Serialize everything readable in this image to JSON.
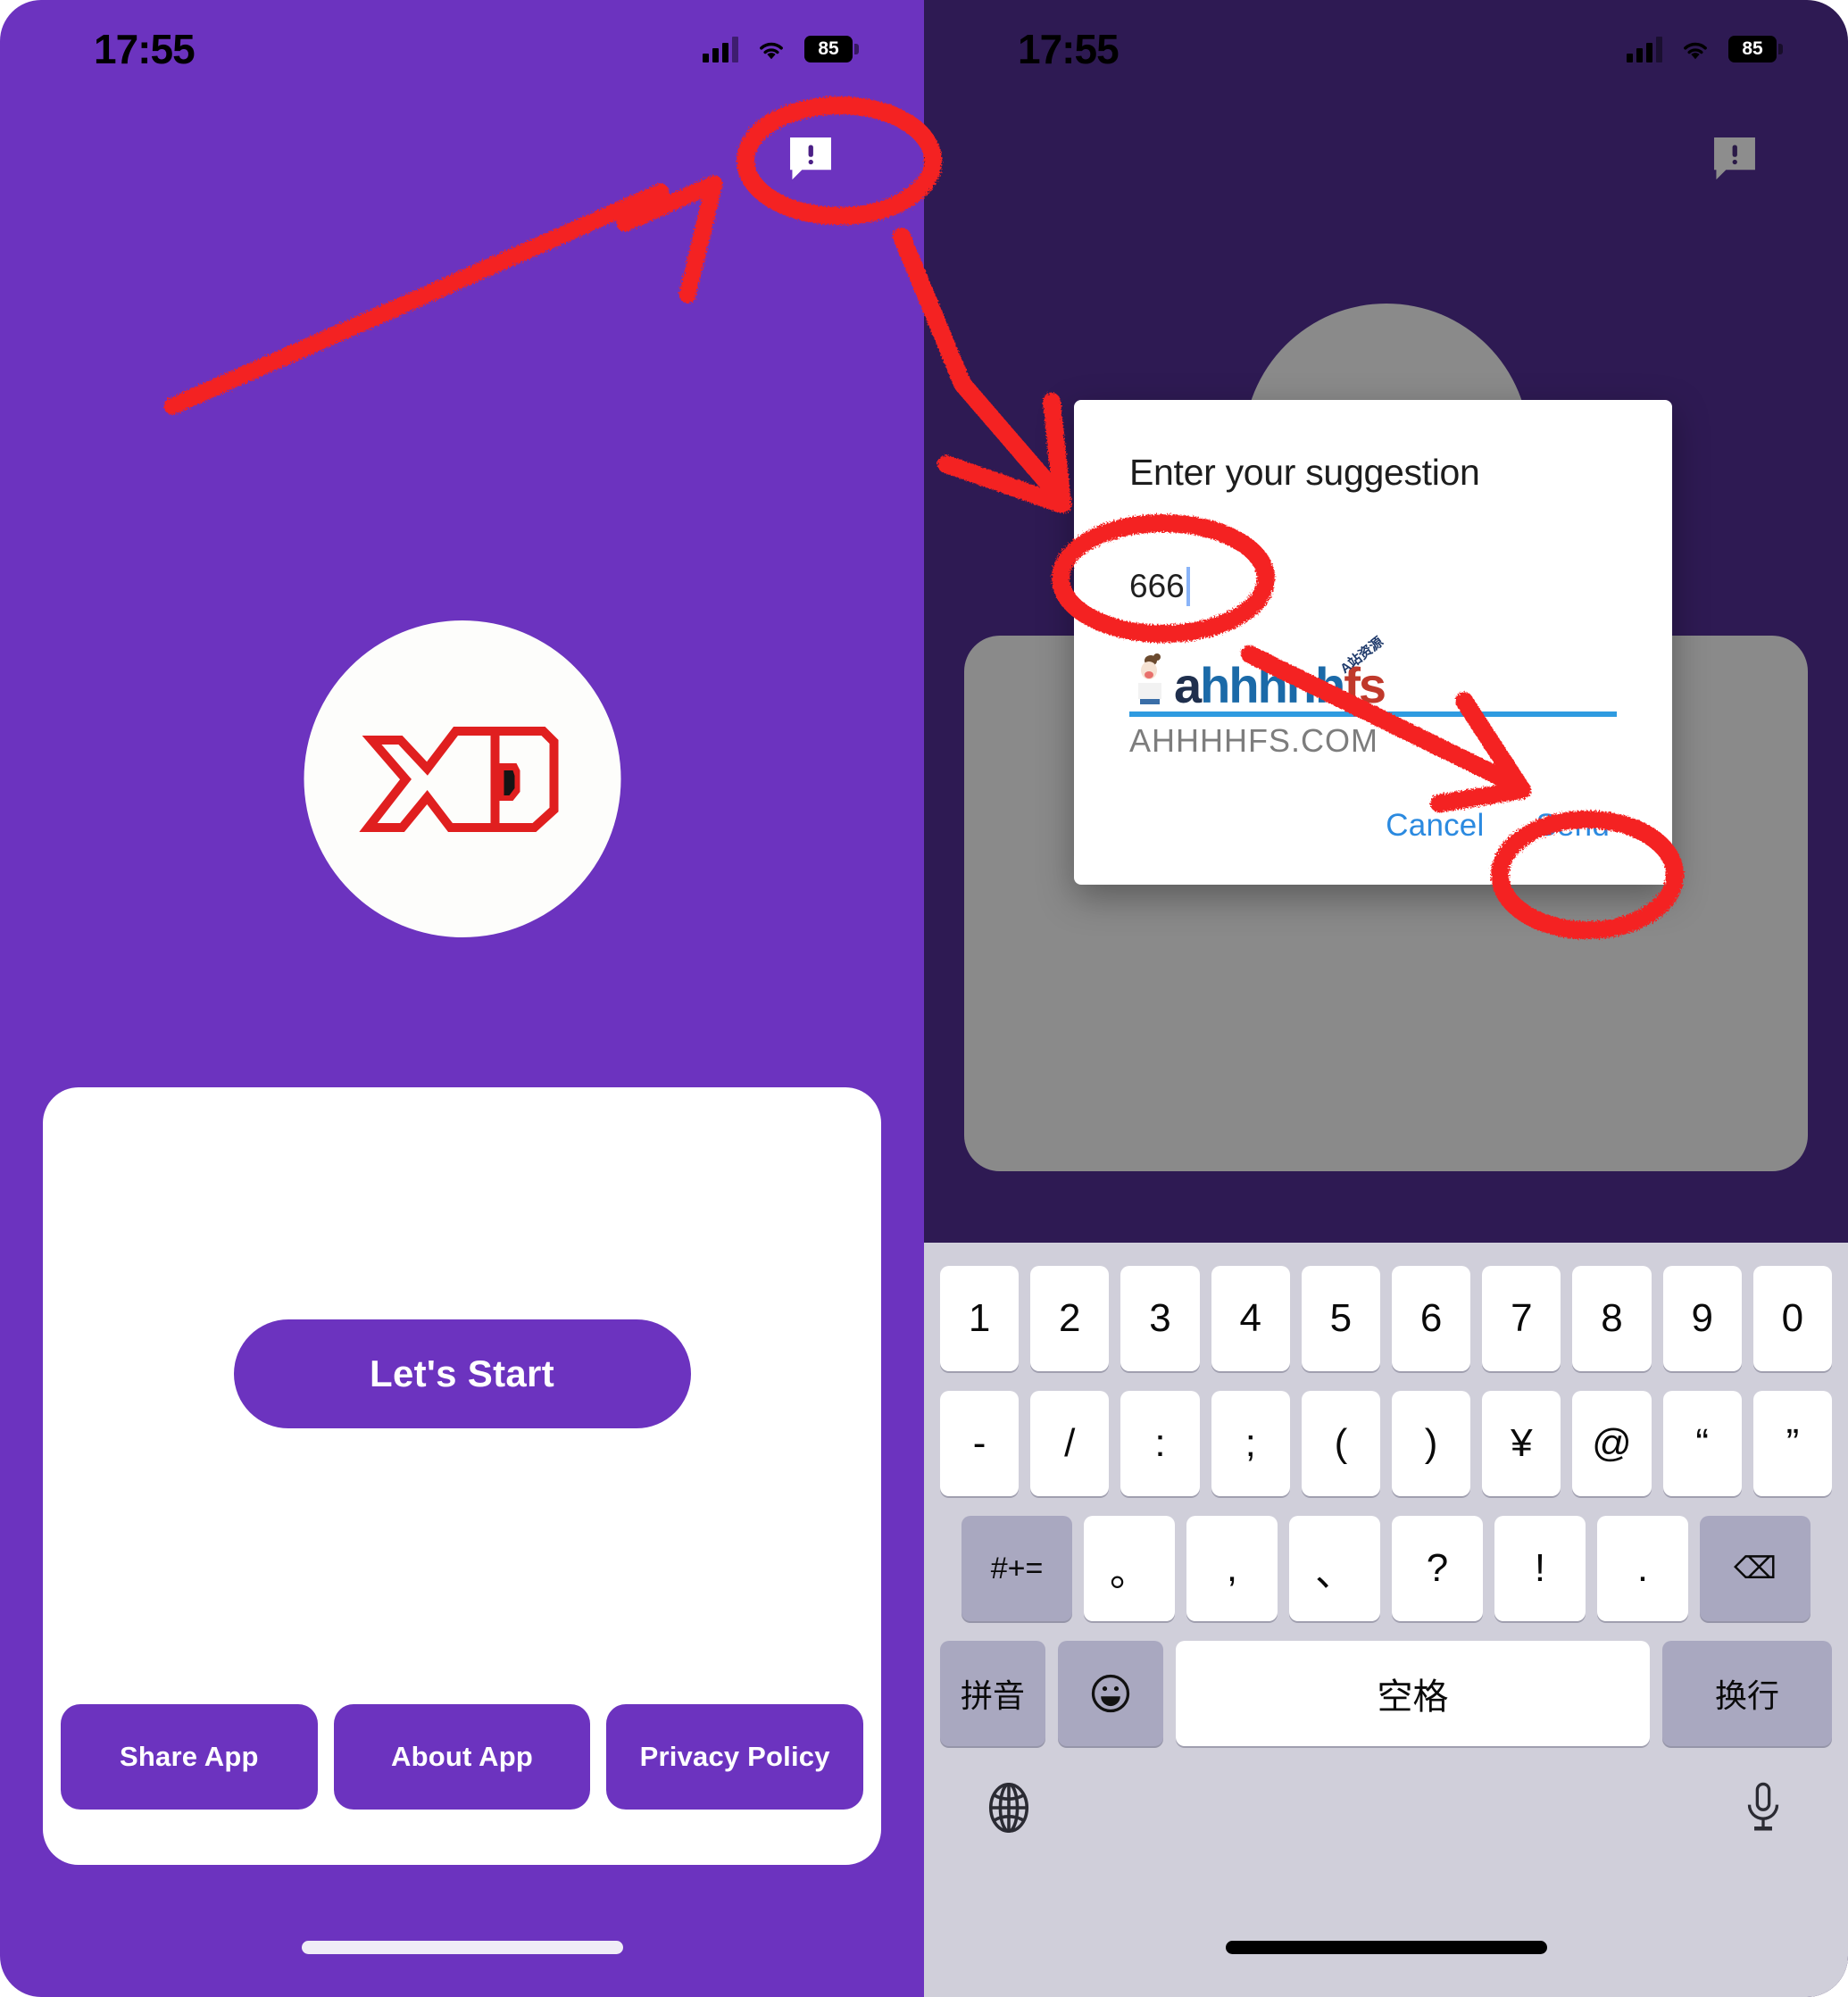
{
  "status_bar": {
    "time": "17:55",
    "battery_level": "85",
    "signal_icon": "cellular-bars-icon",
    "wifi_icon": "wifi-icon",
    "battery_icon": "battery-icon"
  },
  "left_screen": {
    "feedback_icon": "feedback-bubble-icon",
    "logo_alt": "xo-app-logo",
    "start_button": "Let's Start",
    "bottom_buttons": [
      {
        "label": "Share App"
      },
      {
        "label": "About App"
      },
      {
        "label": "Privacy Policy"
      }
    ]
  },
  "right_screen": {
    "feedback_icon": "feedback-bubble-icon",
    "dialog": {
      "title": "Enter your suggestion",
      "input_value": "666",
      "input_placeholder": "",
      "cancel_label": "Cancel",
      "send_label": "Send"
    },
    "watermark": {
      "word_part1": "a",
      "word_part2": "hhhhh",
      "word_part3": "fs",
      "mini_text": "A站资源",
      "domain": "AHHHHFS.COM"
    }
  },
  "keyboard": {
    "row1": [
      "1",
      "2",
      "3",
      "4",
      "5",
      "6",
      "7",
      "8",
      "9",
      "0"
    ],
    "row2": [
      "-",
      "/",
      ":",
      ";",
      "(",
      ")",
      "¥",
      "@",
      "“",
      "”"
    ],
    "row3": [
      "#+=",
      "。",
      ",",
      "、",
      "?",
      "!",
      ".",
      "⌫"
    ],
    "row4": {
      "pinyin": "拼音",
      "emoji": "emoji-icon",
      "space": "空格",
      "return": "换行"
    },
    "globe_icon": "globe-icon",
    "mic_icon": "microphone-icon"
  },
  "colors": {
    "brand_purple": "#6c33bf",
    "dim_purple": "#2e1a53",
    "dialog_action_blue": "#2b8ae0",
    "annotation_red": "#f42222",
    "keyboard_bg": "#d0cfda",
    "watermark_blue": "#2f9be0"
  }
}
